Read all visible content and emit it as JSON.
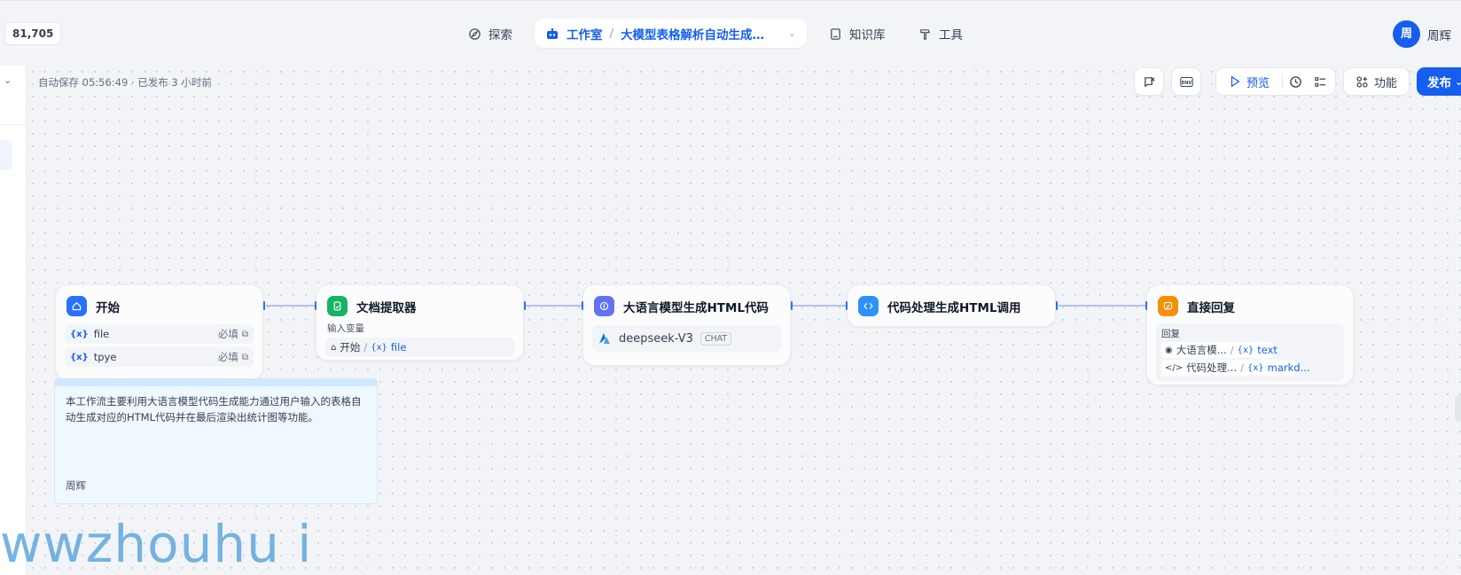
{
  "header": {
    "count": "81,705",
    "nav": {
      "explore": "探索",
      "studio": "工作室",
      "app_name": "大模型表格解析自动生成…",
      "knowledge": "知识库",
      "tools": "工具"
    },
    "user": {
      "avatar_char": "周",
      "name": "周辉"
    }
  },
  "workflow": {
    "save_status": "自动保存 05:56:49 · 已发布 3 小时前",
    "toolbar": {
      "preview_label": "预览",
      "features_label": "功能",
      "publish_label": "发布",
      "env_label": "ENV"
    },
    "nodes": {
      "start": {
        "title": "开始",
        "vars": [
          {
            "name": "file",
            "required": "必填"
          },
          {
            "name": "tpye",
            "required": "必填"
          }
        ]
      },
      "doc_extractor": {
        "title": "文档提取器",
        "input_label": "输入变量",
        "ref_node": "开始",
        "ref_var": "file"
      },
      "llm": {
        "title": "大语言模型生成HTML代码",
        "model": "deepseek-V3",
        "mode_badge": "CHAT"
      },
      "code": {
        "title": "代码处理生成HTML调用"
      },
      "answer": {
        "title": "直接回复",
        "label": "回复",
        "refs": [
          {
            "node": "大语言模...",
            "var": "text"
          },
          {
            "node": "代码处理...",
            "var": "markd..."
          }
        ]
      }
    },
    "note": {
      "text": "本工作流主要利用大语言模型代码生成能力通过用户输入的表格自动生成对应的HTML代码并在最后渲染出统计图等功能。",
      "author": "周辉"
    },
    "watermark": "wwzhouhu i"
  },
  "colors": {
    "accent": "#155eef",
    "start_icon": "#2970ff",
    "doc_icon": "#16b364",
    "llm_icon": "#6172f3",
    "code_icon": "#2e90fa",
    "answer_icon": "#f79009"
  }
}
